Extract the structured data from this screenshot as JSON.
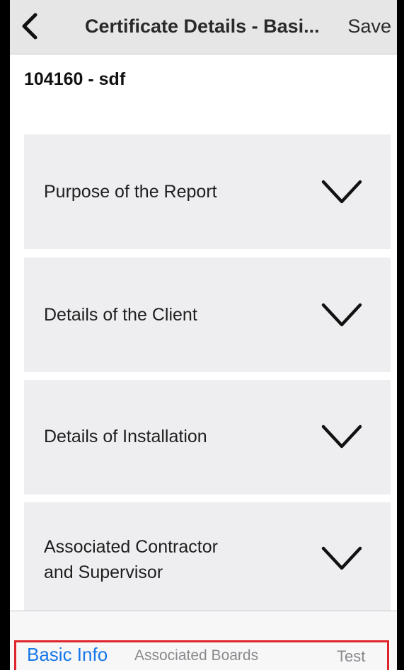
{
  "navbar": {
    "back_icon": "chevron-left-icon",
    "title": "Certificate Details - Basi...",
    "save_label": "Save"
  },
  "record": {
    "title": "104160 - sdf"
  },
  "sections": [
    {
      "label": "Purpose of the Report",
      "icon": "chevron-down-icon"
    },
    {
      "label": "Details of the Client",
      "icon": "chevron-down-icon"
    },
    {
      "label": "Details of Installation",
      "icon": "chevron-down-icon"
    },
    {
      "label_line1": "Associated Contractor",
      "label_line2": "and Supervisor",
      "icon": "chevron-down-icon"
    }
  ],
  "tabs": {
    "basic_info": "Basic Info",
    "associated_boards": "Associated Boards",
    "test": "Test"
  },
  "colors": {
    "navbar_bg": "#e6e6e7",
    "section_bg": "#eeeef0",
    "active_tab": "#1677e8",
    "inactive_tab": "#8a8a8e",
    "highlight_outline": "#e0242c"
  }
}
